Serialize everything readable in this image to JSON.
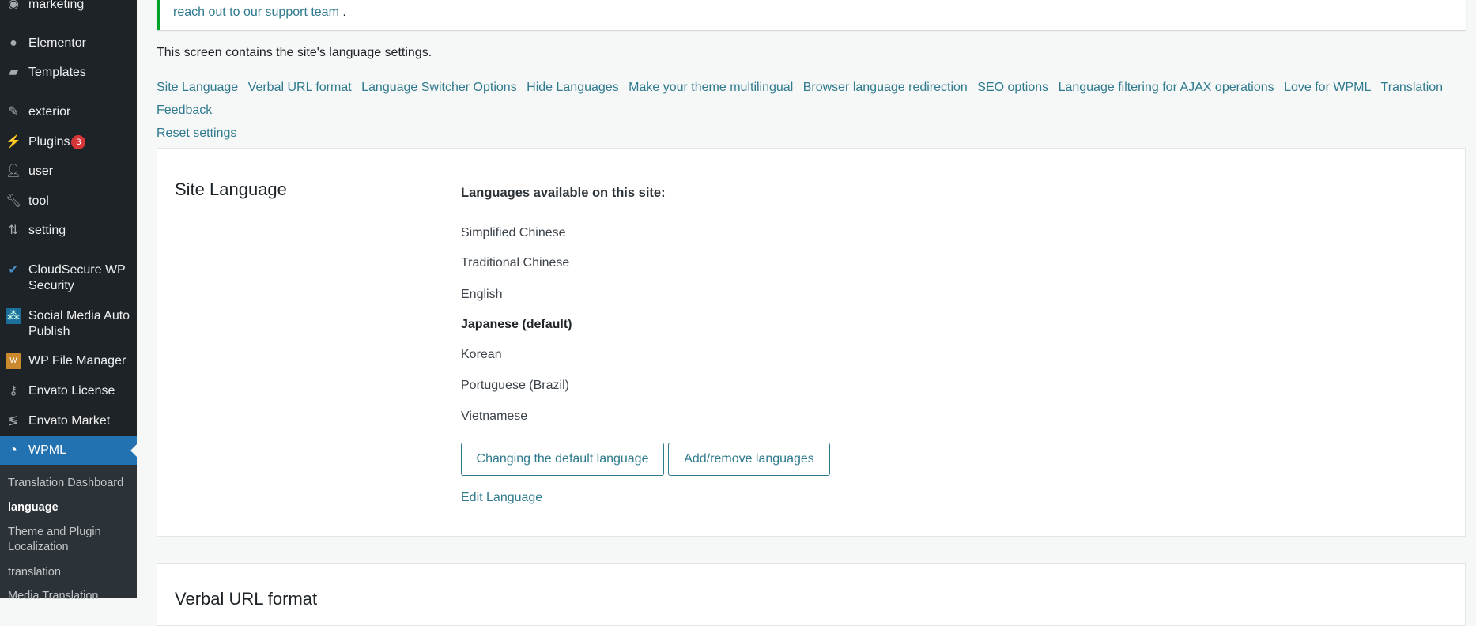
{
  "sidebar": {
    "items": [
      {
        "label": "marketing",
        "icon": "megaphone-icon"
      },
      {
        "label": "Elementor",
        "icon": "elementor-icon"
      },
      {
        "label": "Templates",
        "icon": "folder-icon"
      },
      {
        "label": "exterior",
        "icon": "brush-icon"
      },
      {
        "label": "Plugins",
        "icon": "plug-icon",
        "badge": "3"
      },
      {
        "label": "user",
        "icon": "user-icon"
      },
      {
        "label": "tool",
        "icon": "wrench-icon"
      },
      {
        "label": "setting",
        "icon": "sliders-icon"
      },
      {
        "label": "CloudSecure WP Security",
        "icon": "shield-check-icon"
      },
      {
        "label": "Social Media Auto Publish",
        "icon": "social-icon"
      },
      {
        "label": "WP File Manager",
        "icon": "file-manager-icon"
      },
      {
        "label": "Envato License",
        "icon": "key-icon"
      },
      {
        "label": "Envato Market",
        "icon": "envato-icon"
      },
      {
        "label": "WPML",
        "icon": "wpml-icon"
      }
    ],
    "submenu": [
      "Translation Dashboard",
      "language",
      "Theme and Plugin Localization",
      "translation",
      "Media Translation"
    ]
  },
  "notice": {
    "link": "reach out to our support team",
    "suffix": " ."
  },
  "intro": "This screen contains the site's language settings.",
  "links": [
    "Site Language",
    "Verbal URL format",
    "Language Switcher Options",
    "Hide Languages",
    "Make your theme multilingual",
    "Browser language redirection",
    "SEO options",
    "Language filtering for AJAX operations",
    "Love for WPML",
    "Translation Feedback",
    "Reset settings"
  ],
  "site_language": {
    "title": "Site Language",
    "heading": "Languages available on this site:",
    "languages": [
      "Simplified Chinese",
      "Traditional Chinese",
      "English",
      "Japanese (default)",
      "Korean",
      "Portuguese (Brazil)",
      "Vietnamese"
    ],
    "change_default_button": "Changing the default language",
    "add_remove_button": "Add/remove languages",
    "edit_link": "Edit Language"
  },
  "verbal_url": {
    "title": "Verbal URL format"
  },
  "colors": {
    "accent": "#2271b1",
    "link": "#2f7a8e",
    "sidebar": "#1d2327",
    "notice_border": "#00a32a",
    "badge": "#d63638"
  }
}
